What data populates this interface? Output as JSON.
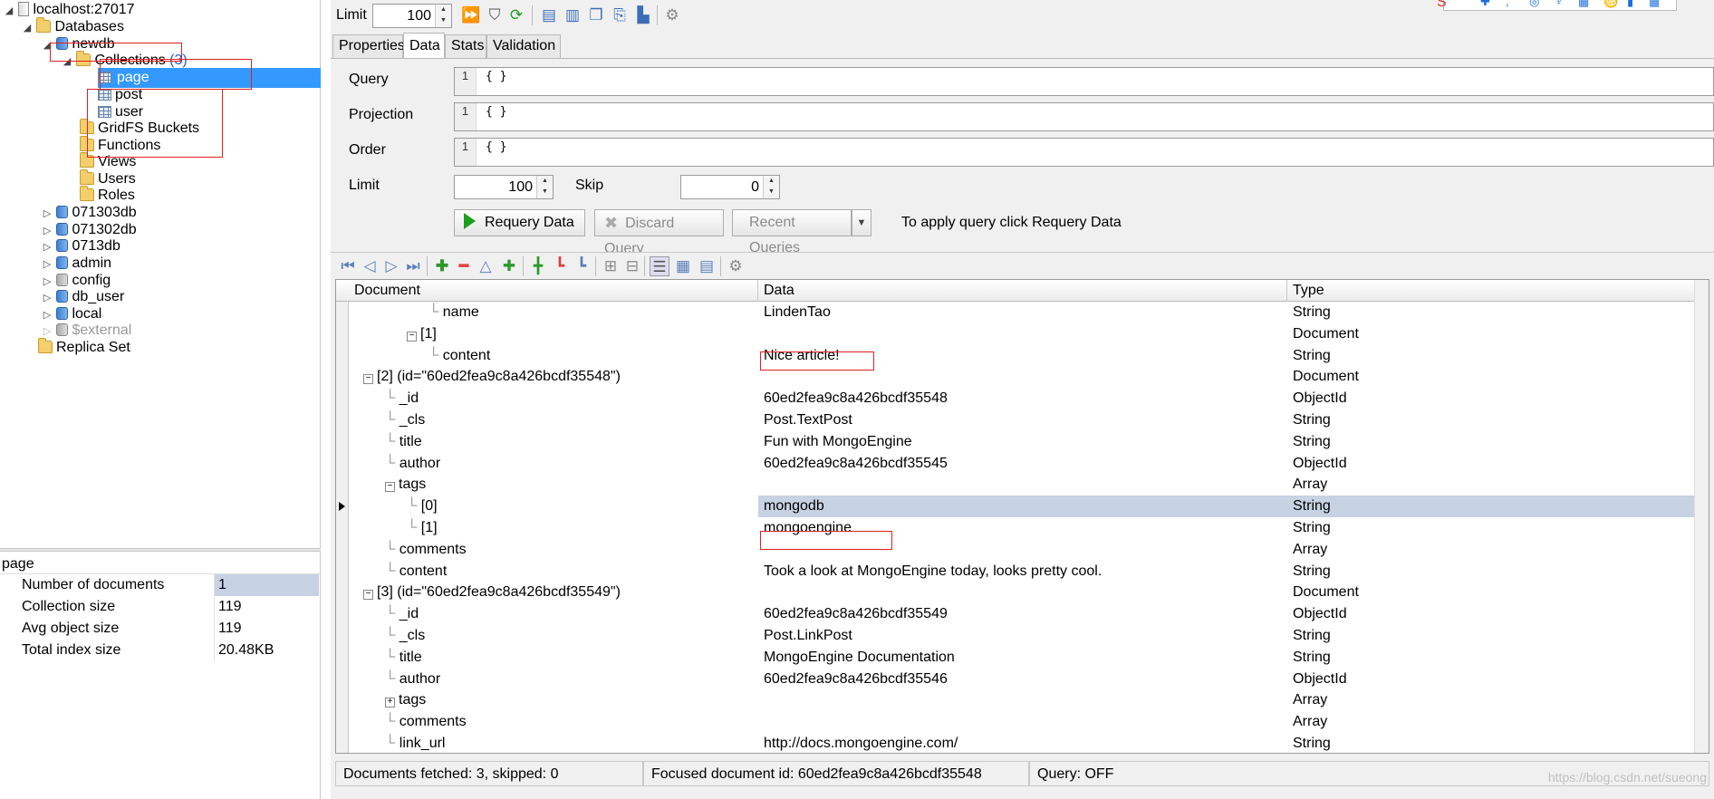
{
  "tree": {
    "server": "localhost:27017",
    "databases_label": "Databases",
    "newdb": "newdb",
    "collections_label": "Collections",
    "collections_count": "(3)",
    "collections": [
      "page",
      "post",
      "user"
    ],
    "gridfs": "GridFS Buckets",
    "functions": "Functions",
    "views": "Views",
    "users": "Users",
    "roles": "Roles",
    "other_dbs": [
      "071303db",
      "071302db",
      "0713db",
      "admin",
      "config",
      "db_user",
      "local"
    ],
    "external": "$external",
    "replica_set": "Replica Set"
  },
  "properties": {
    "title": "page",
    "rows": [
      {
        "key": "Number of documents",
        "value": "1"
      },
      {
        "key": "Collection size",
        "value": "119"
      },
      {
        "key": "Avg object size",
        "value": "119"
      },
      {
        "key": "Total index size",
        "value": "20.48KB"
      }
    ]
  },
  "toolbar": {
    "limit_label": "Limit",
    "limit_value": "100"
  },
  "tabs": [
    "Properties",
    "Data",
    "Stats",
    "Validation"
  ],
  "query": {
    "query_label": "Query",
    "projection_label": "Projection",
    "order_label": "Order",
    "line_no": "1",
    "empty_doc": "{ }",
    "limit_label": "Limit",
    "limit_value": "100",
    "skip_label": "Skip",
    "skip_value": "0",
    "requery_label": "Requery Data",
    "discard_label": "Discard Query",
    "recent_label": "Recent Queries",
    "hint": "To apply query click Requery Data"
  },
  "grid": {
    "headers": [
      "Document",
      "Data",
      "Type"
    ],
    "rows": [
      {
        "doc": "name",
        "data": "LindenTao",
        "type": "String"
      },
      {
        "doc": "[1]",
        "data": "",
        "type": "Document"
      },
      {
        "doc": "content",
        "data": "Nice article!",
        "type": "String"
      },
      {
        "doc": "[2] (id=\"60ed2fea9c8a426bcdf35548\")",
        "data": "",
        "type": "Document"
      },
      {
        "doc": "_id",
        "data": "60ed2fea9c8a426bcdf35548",
        "type": "ObjectId"
      },
      {
        "doc": "_cls",
        "data": "Post.TextPost",
        "type": "String"
      },
      {
        "doc": "title",
        "data": "Fun with MongoEngine",
        "type": "String"
      },
      {
        "doc": "author",
        "data": "60ed2fea9c8a426bcdf35545",
        "type": "ObjectId"
      },
      {
        "doc": "tags",
        "data": "",
        "type": "Array"
      },
      {
        "doc": "[0]",
        "data": "mongodb",
        "type": "String"
      },
      {
        "doc": "[1]",
        "data": "mongoengine",
        "type": "String"
      },
      {
        "doc": "comments",
        "data": "",
        "type": "Array"
      },
      {
        "doc": "content",
        "data": "Took a look at MongoEngine today, looks pretty cool.",
        "type": "String"
      },
      {
        "doc": "[3] (id=\"60ed2fea9c8a426bcdf35549\")",
        "data": "",
        "type": "Document"
      },
      {
        "doc": "_id",
        "data": "60ed2fea9c8a426bcdf35549",
        "type": "ObjectId"
      },
      {
        "doc": "_cls",
        "data": "Post.LinkPost",
        "type": "String"
      },
      {
        "doc": "title",
        "data": "MongoEngine Documentation",
        "type": "String"
      },
      {
        "doc": "author",
        "data": "60ed2fea9c8a426bcdf35546",
        "type": "ObjectId"
      },
      {
        "doc": "tags",
        "data": "",
        "type": "Array"
      },
      {
        "doc": "comments",
        "data": "",
        "type": "Array"
      },
      {
        "doc": "link_url",
        "data": "http://docs.mongoengine.com/",
        "type": "String"
      }
    ]
  },
  "status": {
    "fetched": "Documents fetched: 3, skipped: 0",
    "focused": "Focused document id: 60ed2fea9c8a426bcdf35548",
    "query": "Query: OFF"
  },
  "watermark": "https://blog.csdn.net/sueong"
}
